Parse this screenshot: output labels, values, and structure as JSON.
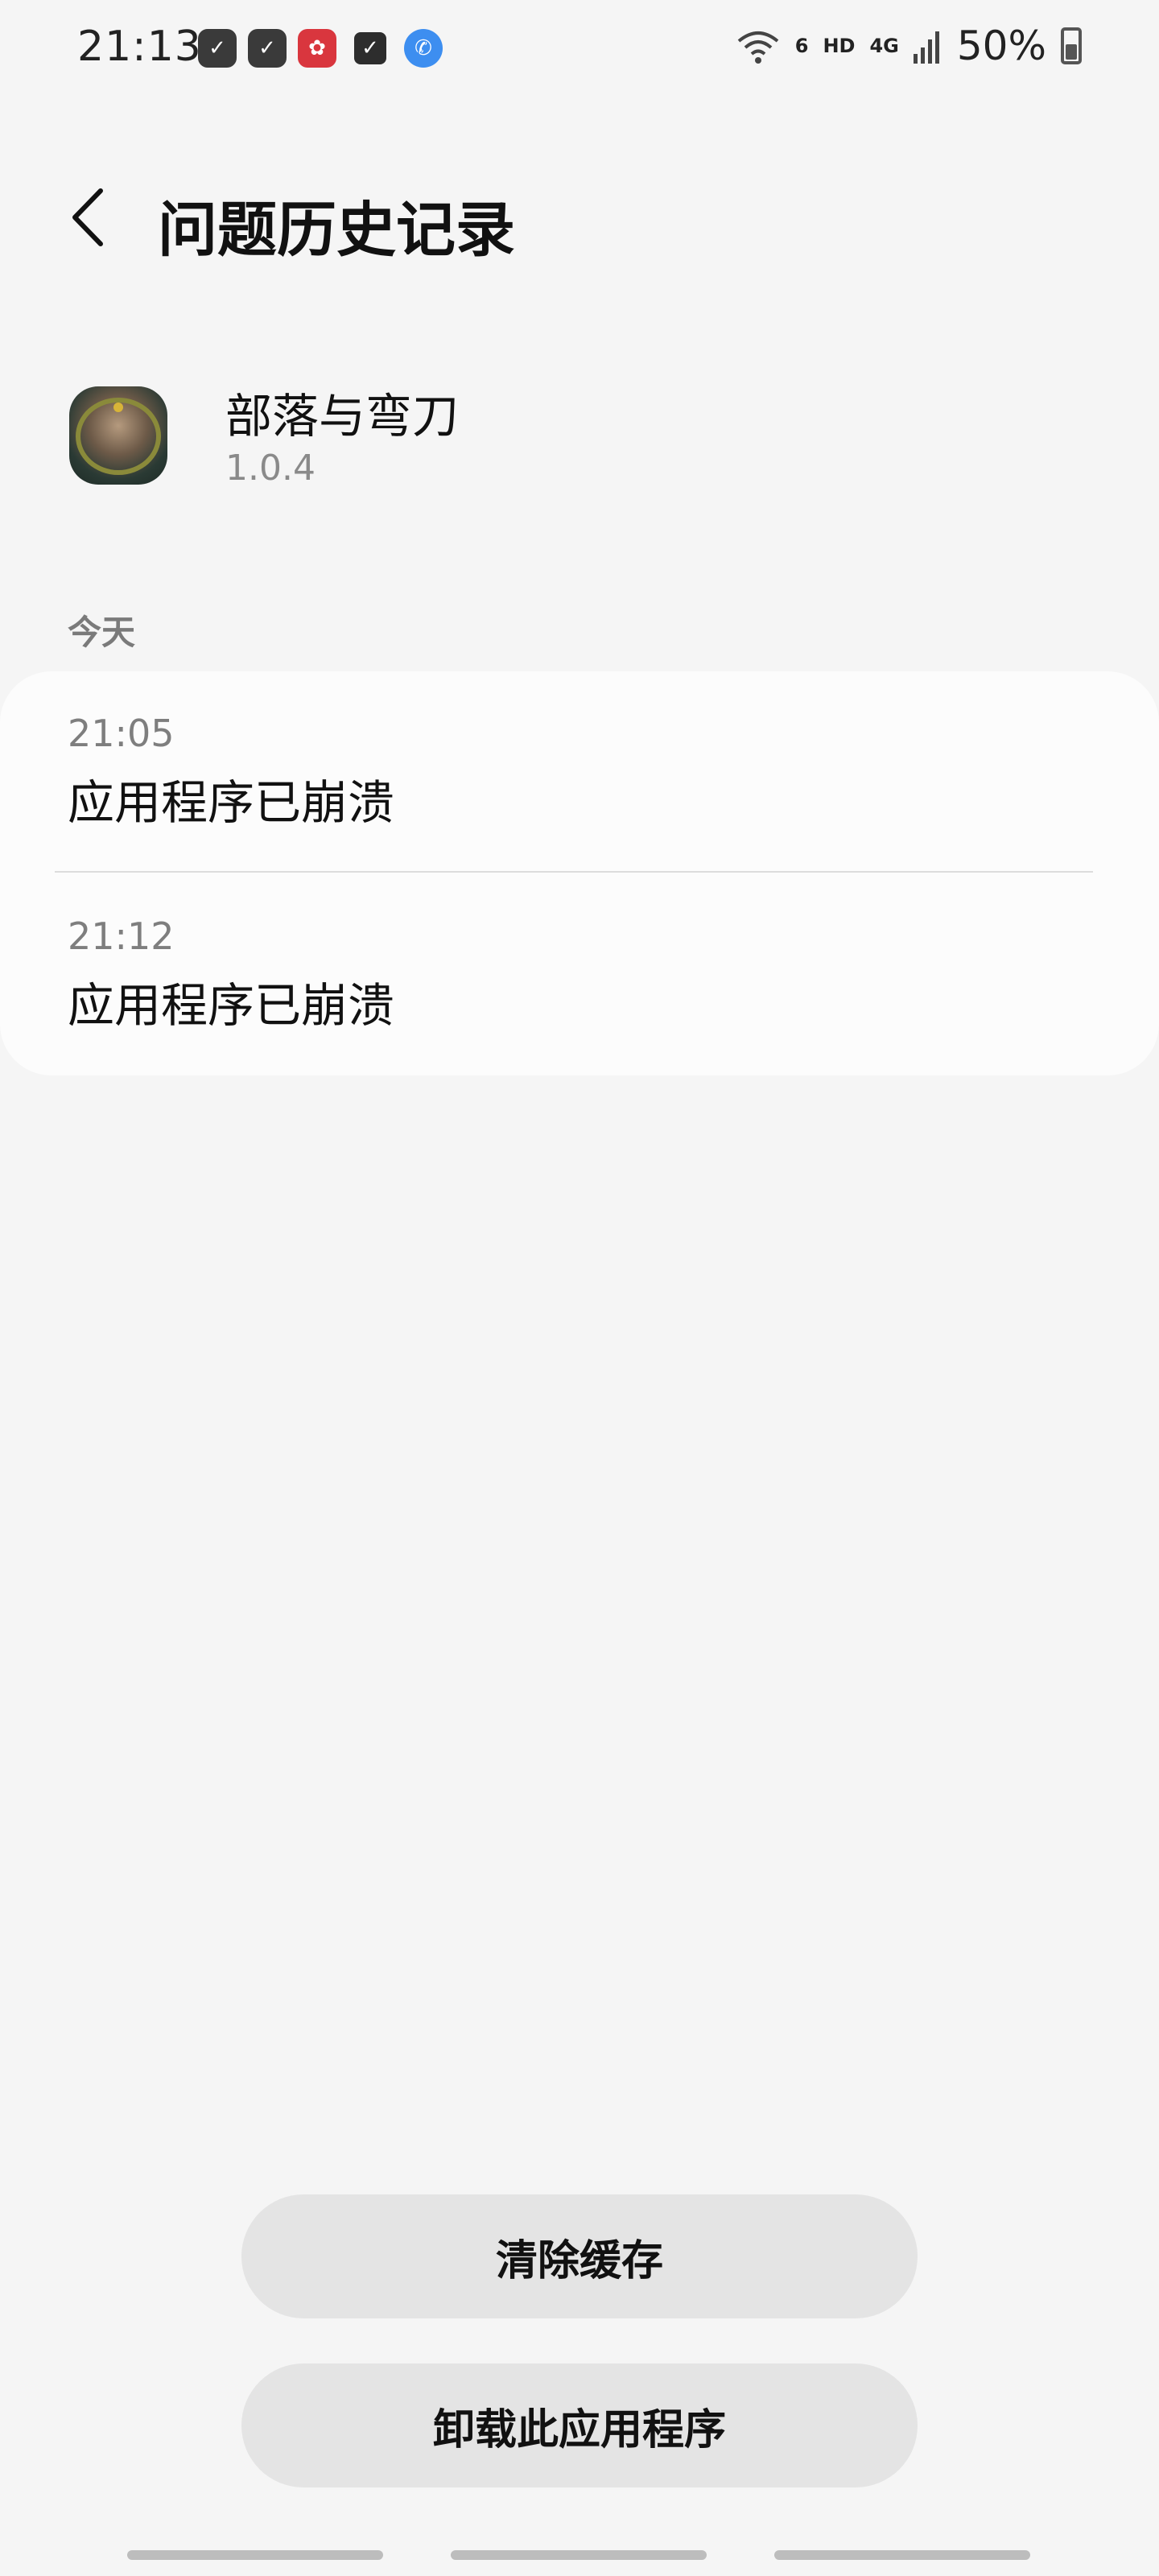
{
  "status_bar": {
    "time": "21:13",
    "notification_icons": [
      "task-check-icon",
      "task-check-icon",
      "flower-app-icon",
      "checkbox-icon",
      "phone-icon"
    ],
    "network_wifi_label": "6",
    "hd_label": "HD",
    "cell_label": "4G",
    "battery_percent": "50%"
  },
  "header": {
    "title": "问题历史记录",
    "back_icon": "chevron-left-icon"
  },
  "app": {
    "name": "部落与弯刀",
    "version": "1.0.4"
  },
  "section": {
    "label": "今天"
  },
  "crashes": [
    {
      "time": "21:05",
      "message": "应用程序已崩溃"
    },
    {
      "time": "21:12",
      "message": "应用程序已崩溃"
    }
  ],
  "actions": {
    "clear_cache": "清除缓存",
    "uninstall": "卸载此应用程序"
  },
  "colors": {
    "background": "#f5f5f5",
    "card": "#fcfcfc",
    "button": "#e4e4e4",
    "secondary_text": "#7e7e7e"
  }
}
